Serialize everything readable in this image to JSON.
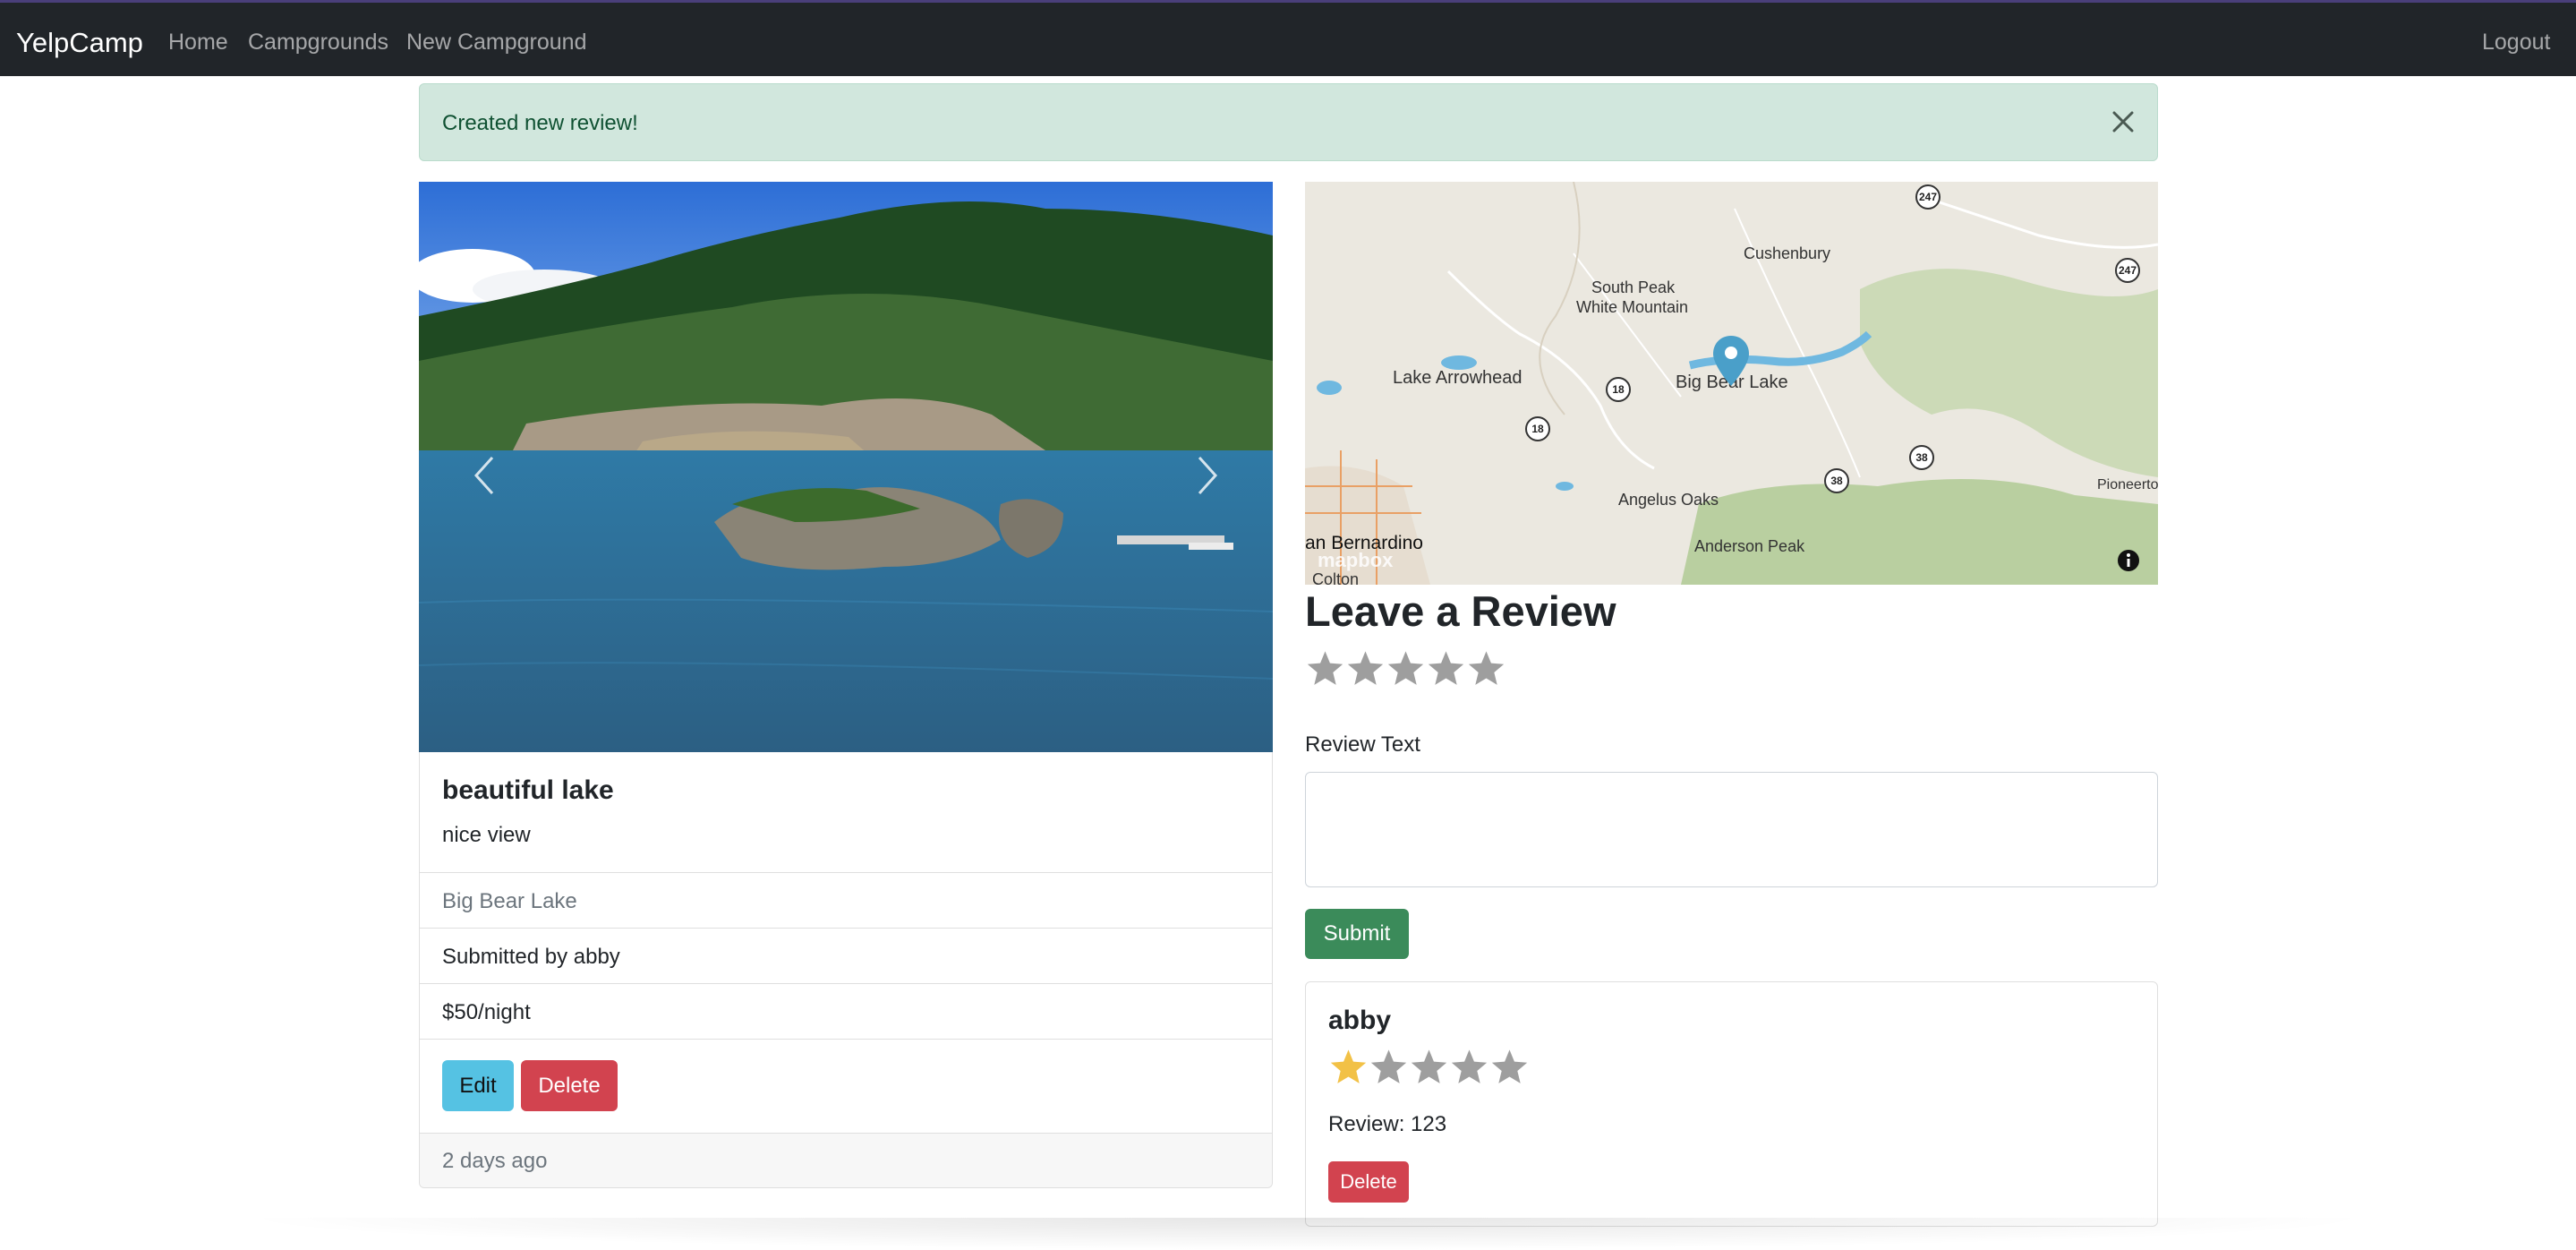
{
  "navbar": {
    "brand": "YelpCamp",
    "links": [
      "Home",
      "Campgrounds",
      "New Campground"
    ],
    "logout": "Logout"
  },
  "alert": {
    "message": "Created new review!",
    "close_icon": "close-icon"
  },
  "carousel": {
    "prev_icon": "chevron-left-icon",
    "next_icon": "chevron-right-icon"
  },
  "campground": {
    "title": "beautiful lake",
    "description": "nice view",
    "location": "Big Bear Lake",
    "submitted_by": "Submitted by abby",
    "price": "$50/night",
    "edit_label": "Edit",
    "delete_label": "Delete",
    "footer": "2 days ago"
  },
  "map": {
    "labels": {
      "cushenbury": "Cushenbury",
      "south_peak": "South Peak",
      "white_mountain": "White Mountain",
      "lake_arrowhead": "Lake Arrowhead",
      "big_bear_lake": "Big Bear Lake",
      "angelus_oaks": "Angelus Oaks",
      "anderson_peak": "Anderson Peak",
      "san_bernardino": "an Bernardino",
      "colton": "Colton",
      "pioneertown": "Pioneerto"
    },
    "routes": [
      "247",
      "247",
      "18",
      "18",
      "38",
      "38"
    ],
    "attribution": "mapbox",
    "info_icon": "info-icon",
    "marker_icon": "map-pin-icon"
  },
  "review_form": {
    "heading": "Leave a Review",
    "rating": 0,
    "text_label": "Review Text",
    "text_value": "",
    "submit_label": "Submit"
  },
  "reviews": [
    {
      "author": "abby",
      "rating": 1,
      "body": "Review: 123",
      "delete_label": "Delete"
    }
  ],
  "colors": {
    "navbar": "#212529",
    "alert_bg": "#d1e7dd",
    "edit_button": "#55c2e3",
    "delete_button": "#d2434f",
    "submit_button": "#3b8b5a",
    "star_filled": "#f2c146",
    "star_empty": "#9e9e9e"
  }
}
